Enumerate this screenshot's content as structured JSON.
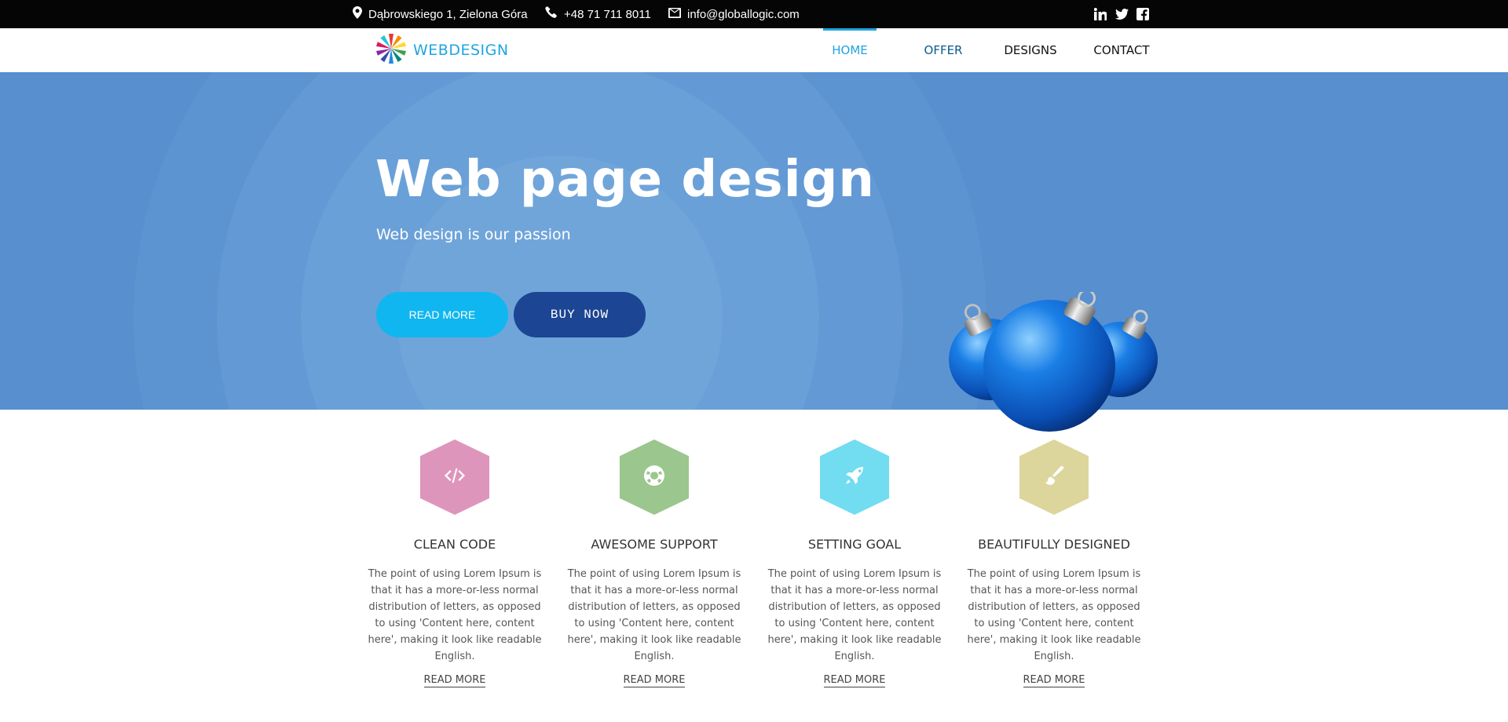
{
  "topbar": {
    "address": "Dąbrowskiego 1, Zielona Góra",
    "phone": "+48 71 711 8011",
    "email": "info@globallogic.com",
    "icons": [
      "map-pin-icon",
      "phone-icon",
      "envelope-icon",
      "linkedin-icon",
      "twitter-icon",
      "facebook-icon"
    ]
  },
  "nav": {
    "logo_text": "WEBDESIGN",
    "items": [
      {
        "label": "HOME",
        "active": true
      },
      {
        "label": "OFFER",
        "active": false
      },
      {
        "label": "DESIGNS",
        "active": false
      },
      {
        "label": "CONTACT",
        "active": false
      }
    ]
  },
  "hero": {
    "title": "Web page design",
    "subtitle": "Web design is our passion",
    "read_more_label": "READ MORE",
    "buy_now_label": "BUY NOW"
  },
  "features": [
    {
      "title": "CLEAN CODE",
      "icon": "code-icon",
      "color": "#de95bb",
      "text": "The point of using Lorem Ipsum is that it has a more-or-less normal distribution of letters, as opposed to using 'Content here, content here', making it look like readable English.",
      "link": "READ MORE"
    },
    {
      "title": "AWESOME SUPPORT",
      "icon": "life-ring-icon",
      "color": "#9bc68d",
      "text": "The point of using Lorem Ipsum is that it has a more-or-less normal distribution of letters, as opposed to using 'Content here, content here', making it look like readable English.",
      "link": "READ MORE"
    },
    {
      "title": "SETTING GOAL",
      "icon": "rocket-icon",
      "color": "#72dcf0",
      "text": "The point of using Lorem Ipsum is that it has a more-or-less normal distribution of letters, as opposed to using 'Content here, content here', making it look like readable English.",
      "link": "READ MORE"
    },
    {
      "title": "BEAUTIFULLY DESIGNED",
      "icon": "paint-brush-icon",
      "color": "#ddd69c",
      "text": "The point of using Lorem Ipsum is that it has a more-or-less normal distribution of letters, as opposed to using 'Content here, content here', making it look like readable English.",
      "link": "READ MORE"
    }
  ],
  "colors": {
    "accent": "#1fa5e0",
    "hero_bg": "#578fcf",
    "read_more_bg": "#10b6ef",
    "buy_now_bg": "#1c4593"
  }
}
